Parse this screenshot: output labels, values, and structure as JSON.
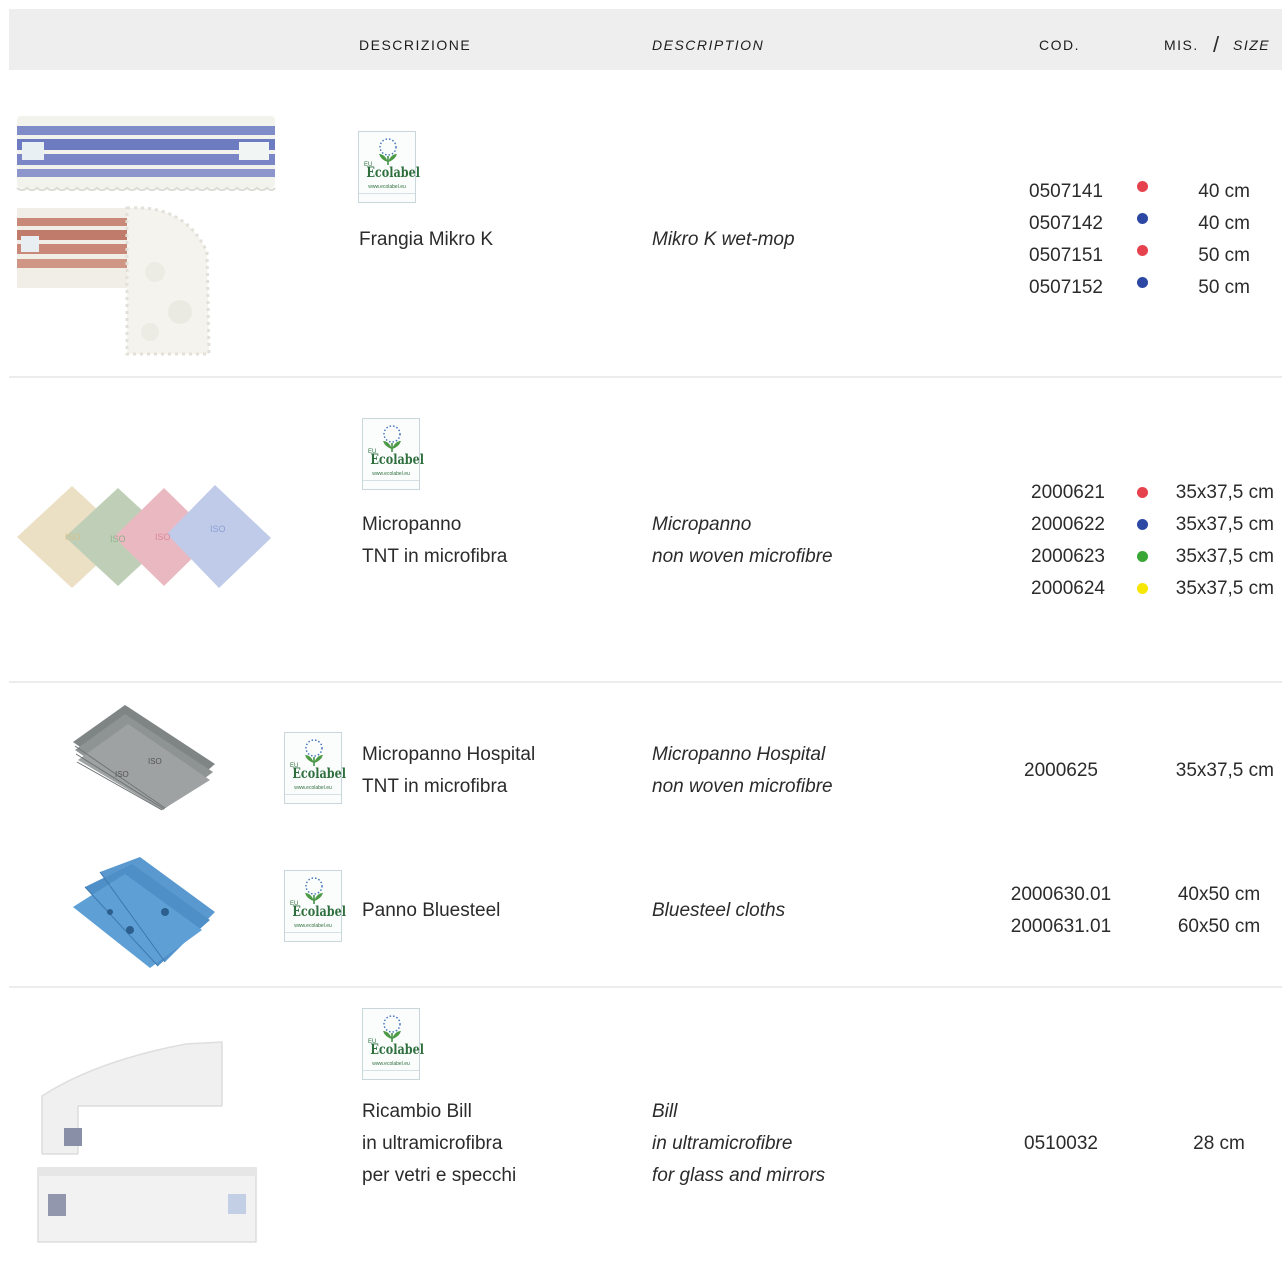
{
  "header": {
    "descrizione": "DESCRIZIONE",
    "description": "DESCRIPTION",
    "cod": "COD.",
    "mis": "MIS.",
    "slash": "/",
    "size": "SIZE"
  },
  "ecolabel": {
    "eu": "EU",
    "word": "Ecolabel",
    "url": "www.ecolabel.eu"
  },
  "colors": {
    "red": "#e5424d",
    "blue": "#2c48a3",
    "green": "#3aa635",
    "yellow": "#f7e600"
  },
  "products": [
    {
      "it_lines": [
        "Frangia Mikro K"
      ],
      "en_lines": [
        "Mikro K wet-mop"
      ],
      "variants": [
        {
          "code": "0507141",
          "color": "red",
          "size": "40 cm"
        },
        {
          "code": "0507142",
          "color": "blue",
          "size": "40 cm"
        },
        {
          "code": "0507151",
          "color": "red",
          "size": "50 cm"
        },
        {
          "code": "0507152",
          "color": "blue",
          "size": "50 cm"
        }
      ]
    },
    {
      "it_lines": [
        "Micropanno",
        "TNT in microfibra"
      ],
      "en_lines": [
        "Micropanno",
        "non woven microfibre"
      ],
      "variants": [
        {
          "code": "2000621",
          "color": "red",
          "size": "35x37,5 cm"
        },
        {
          "code": "2000622",
          "color": "blue",
          "size": "35x37,5 cm"
        },
        {
          "code": "2000623",
          "color": "green",
          "size": "35x37,5 cm"
        },
        {
          "code": "2000624",
          "color": "yellow",
          "size": "35x37,5 cm"
        }
      ]
    },
    {
      "it_lines": [
        "Micropanno Hospital",
        "TNT in microfibra"
      ],
      "en_lines": [
        "Micropanno Hospital",
        "non woven microfibre"
      ],
      "variants": [
        {
          "code": "2000625",
          "size": "35x37,5 cm"
        }
      ]
    },
    {
      "it_lines": [
        "Panno Bluesteel"
      ],
      "en_lines": [
        "Bluesteel cloths"
      ],
      "variants": [
        {
          "code": "2000630.01",
          "size": "40x50 cm"
        },
        {
          "code": "2000631.01",
          "size": "60x50 cm"
        }
      ]
    },
    {
      "it_lines": [
        "Ricambio Bill",
        "in ultramicrofibra",
        "per vetri e specchi"
      ],
      "en_lines": [
        "Bill",
        "in ultramicrofibre",
        "for glass and mirrors"
      ],
      "variants": [
        {
          "code": "0510032",
          "size": "28 cm"
        }
      ]
    }
  ]
}
